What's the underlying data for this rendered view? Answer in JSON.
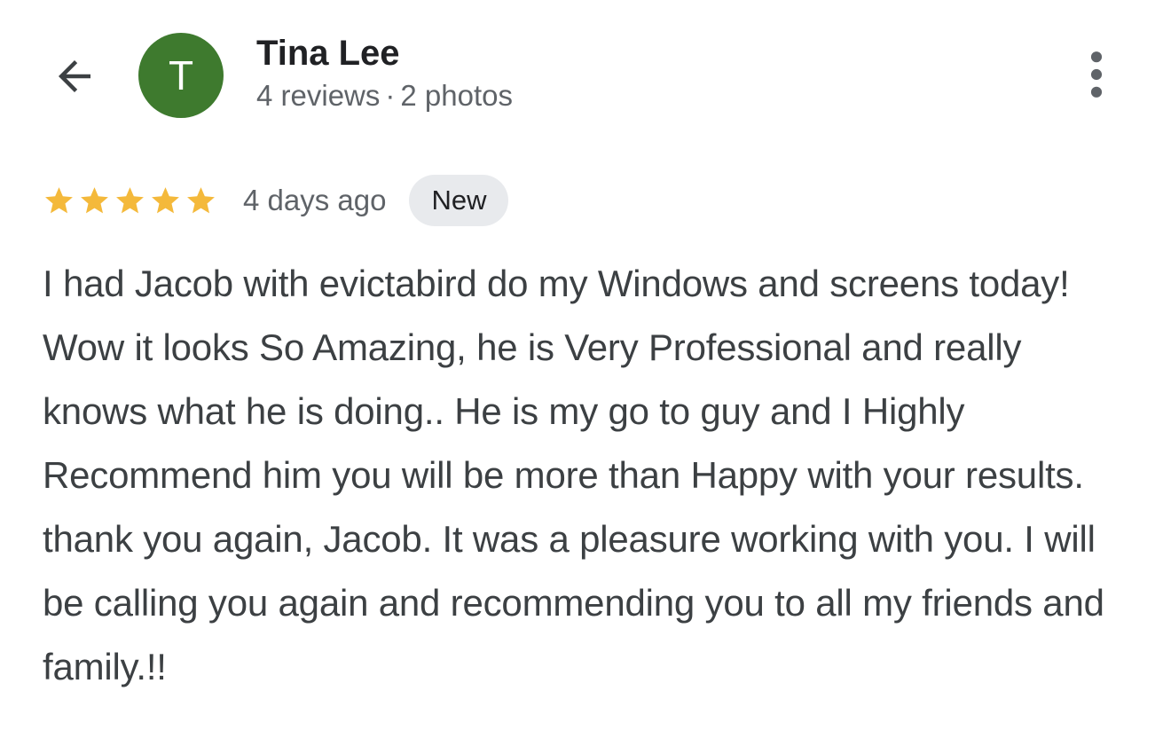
{
  "header": {
    "back_icon": "arrow-left-icon",
    "avatar_initial": "T",
    "avatar_color": "#3e7a2e",
    "reviewer_name": "Tina Lee",
    "reviews_count": "4 reviews",
    "meta_separator": "·",
    "photos_count": "2 photos",
    "more_icon": "more-vertical-icon"
  },
  "review": {
    "rating": 5,
    "max_rating": 5,
    "star_color": "#f4b93b",
    "time": "4 days ago",
    "badge": "New",
    "text": "I had Jacob with evictabird do my Windows and screens today! Wow it looks So Amazing, he is Very Professional and really knows what he is doing.. He is my go to guy and I Highly Recommend him you will be more than Happy with your results. thank you again, Jacob. It was a pleasure working with you. I will be calling you again and recommending you to all my friends and family.!!"
  }
}
